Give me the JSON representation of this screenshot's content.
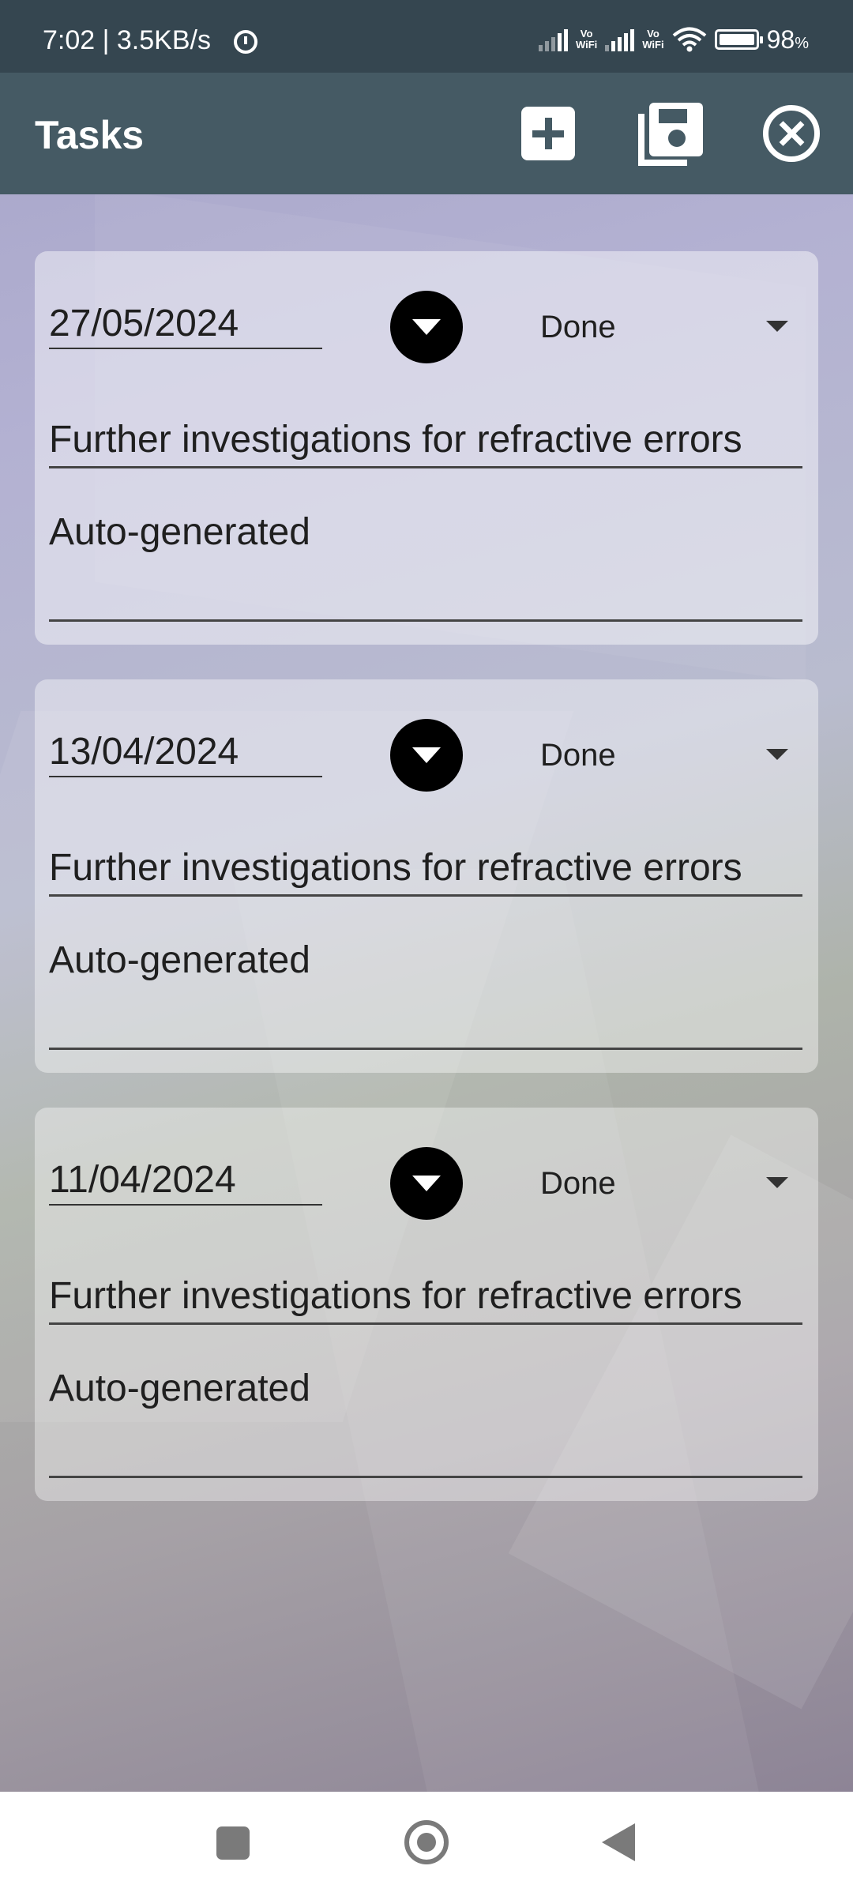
{
  "status_bar": {
    "time": "7:02 | 3.5KB/s",
    "vowifi_label": "Vo\nWiFi",
    "battery": "98",
    "battery_unit": "%"
  },
  "app_bar": {
    "title": "Tasks",
    "add_icon": "plus-box-icon",
    "save_icon": "content-save-all-icon",
    "close_icon": "close-circle-icon"
  },
  "tasks": [
    {
      "date": "27/05/2024",
      "status": "Done",
      "title": "Further investigations for refractive errors",
      "notes": "Auto-generated"
    },
    {
      "date": "13/04/2024",
      "status": "Done",
      "title": "Further investigations for refractive errors",
      "notes": "Auto-generated"
    },
    {
      "date": "11/04/2024",
      "status": "Done",
      "title": "Further investigations for refractive errors",
      "notes": "Auto-generated"
    }
  ],
  "colors": {
    "status_bar": "#354650",
    "app_bar": "#455a64",
    "accent_text": "#ffffff"
  }
}
